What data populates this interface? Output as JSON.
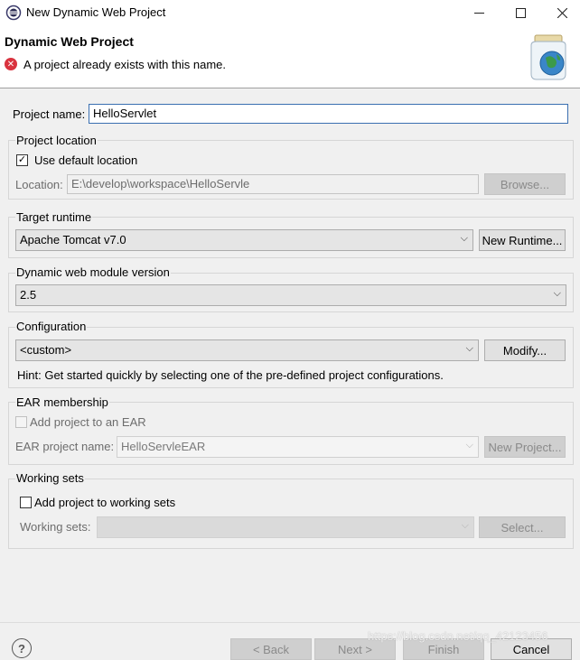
{
  "window": {
    "title": "New Dynamic Web Project",
    "min_icon": "minimize-icon",
    "max_icon": "maximize-icon",
    "close_icon": "close-icon"
  },
  "header": {
    "title": "Dynamic Web Project",
    "error_message": "A project already exists with this name."
  },
  "project_name": {
    "label": "Project name:",
    "value": "HelloServlet"
  },
  "project_location": {
    "group_title": "Project location",
    "use_default_label": "Use default location",
    "use_default_checked": true,
    "location_label": "Location:",
    "location_value": "E:\\develop\\workspace\\HelloServle",
    "browse_label": "Browse..."
  },
  "target_runtime": {
    "group_title": "Target runtime",
    "selected": "Apache Tomcat v7.0",
    "new_runtime_label": "New Runtime..."
  },
  "web_module_version": {
    "group_title": "Dynamic web module version",
    "selected": "2.5"
  },
  "configuration": {
    "group_title": "Configuration",
    "selected": "<custom>",
    "modify_label": "Modify...",
    "hint": "Hint: Get started quickly by selecting one of the pre-defined project configurations."
  },
  "ear_membership": {
    "group_title": "EAR membership",
    "add_label": "Add project to an EAR",
    "ear_name_label": "EAR project name:",
    "ear_name_value": "HelloServleEAR",
    "new_project_label": "New Project..."
  },
  "working_sets": {
    "group_title": "Working sets",
    "add_label": "Add project to working sets",
    "sets_label": "Working sets:",
    "sets_value": "",
    "select_label": "Select..."
  },
  "footer": {
    "back_label": "< Back",
    "next_label": "Next >",
    "finish_label": "Finish",
    "cancel_label": "Cancel",
    "help_icon": "help-icon"
  },
  "watermark": "https://blog.csdn.net/qq_42123456",
  "colors": {
    "error": "#d9333f",
    "background": "#f0f0f0",
    "header": "#ffffff"
  }
}
